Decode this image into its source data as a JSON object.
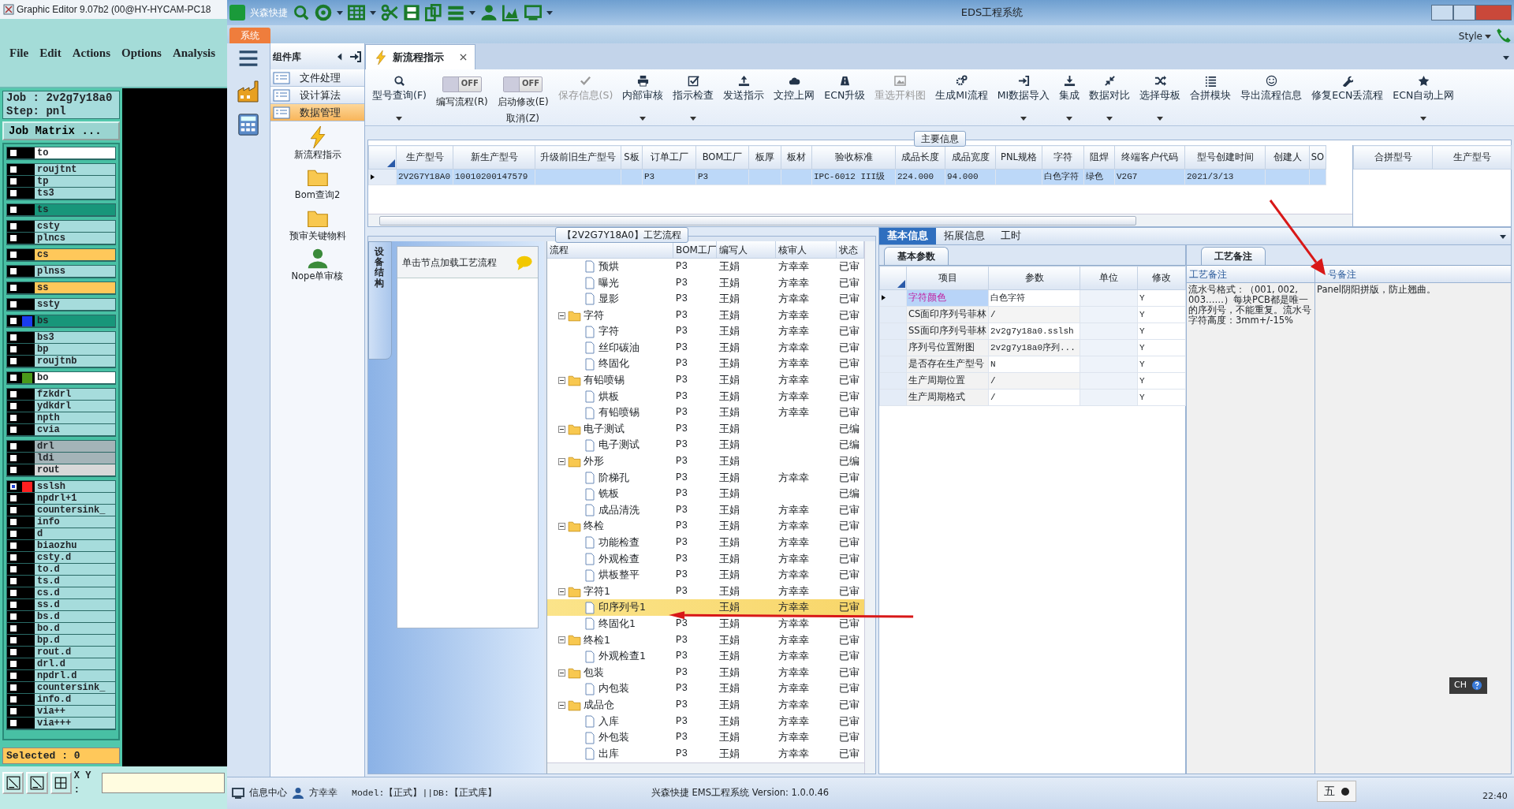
{
  "graphic_editor": {
    "title": "Graphic Editor 9.07b2 (00@HY-HYCAM-PC18",
    "menu": [
      "File",
      "Edit",
      "Actions",
      "Options",
      "Analysis"
    ],
    "job": "Job : 2v2g7y18a0",
    "step": "Step: pnl",
    "job_matrix": "Job Matrix ...",
    "layer_groups": [
      [
        {
          "name": "to",
          "color": "#ffffff",
          "selected": false
        }
      ],
      [
        {
          "name": "roujtnt",
          "color": "#a6dcdc",
          "selected": false
        },
        {
          "name": "tp",
          "color": "#a6dcdc",
          "selected": false
        },
        {
          "name": "ts3",
          "color": "#a6dcdc",
          "selected": false
        }
      ],
      [
        {
          "name": "ts",
          "color": "#18967a",
          "selected": false
        }
      ],
      [
        {
          "name": "csty",
          "color": "#a6dcdc",
          "selected": false
        },
        {
          "name": "plncs",
          "color": "#a6dcdc",
          "selected": false
        }
      ],
      [
        {
          "name": "cs",
          "color": "#ffc85a",
          "selected": false
        }
      ],
      [
        {
          "name": "plnss",
          "color": "#a6dcdc",
          "selected": false
        }
      ],
      [
        {
          "name": "ss",
          "color": "#ffc85a",
          "selected": false
        }
      ],
      [
        {
          "name": "ssty",
          "color": "#a6dcdc",
          "selected": false
        }
      ],
      [
        {
          "name": "bs",
          "color": "#18967a",
          "marker": {
            "color": "#1a3cf0"
          },
          "selected": false
        }
      ],
      [
        {
          "name": "bs3",
          "color": "#a6dcdc",
          "selected": false
        },
        {
          "name": "bp",
          "color": "#a6dcdc",
          "selected": false
        },
        {
          "name": "roujtnb",
          "color": "#a6dcdc",
          "selected": false
        }
      ],
      [
        {
          "name": "bo",
          "color": "#ffffff",
          "marker": {
            "color": "#4a9a1a"
          },
          "selected": false
        }
      ],
      [
        {
          "name": "fzkdrl",
          "color": "#a6dcdc",
          "selected": false
        },
        {
          "name": "ydkdrl",
          "color": "#a6dcdc",
          "selected": false
        },
        {
          "name": "npth",
          "color": "#a6dcdc",
          "selected": false
        },
        {
          "name": "cvia",
          "color": "#a6dcdc",
          "selected": false
        }
      ],
      [
        {
          "name": "drl",
          "color": "#a4b4b8",
          "selected": false
        },
        {
          "name": "ldi",
          "color": "#a4b4b8",
          "selected": false
        },
        {
          "name": "rout",
          "color": "#d8d8d8",
          "selected": false
        }
      ],
      [
        {
          "name": "sslsh",
          "color": "#a6dcdc",
          "marker": {
            "color": "#ff2020"
          },
          "selected": true
        },
        {
          "name": "npdrl+1",
          "color": "#a6dcdc",
          "selected": false
        },
        {
          "name": "countersink_",
          "color": "#a6dcdc",
          "selected": false
        },
        {
          "name": "info",
          "color": "#a6dcdc",
          "selected": false
        },
        {
          "name": "d",
          "color": "#a6dcdc",
          "selected": false
        },
        {
          "name": "biaozhu",
          "color": "#a6dcdc",
          "selected": false
        },
        {
          "name": "csty.d",
          "color": "#a6dcdc",
          "selected": false
        },
        {
          "name": "to.d",
          "color": "#a6dcdc",
          "selected": false
        },
        {
          "name": "ts.d",
          "color": "#a6dcdc",
          "selected": false
        },
        {
          "name": "cs.d",
          "color": "#a6dcdc",
          "selected": false
        },
        {
          "name": "ss.d",
          "color": "#a6dcdc",
          "selected": false
        },
        {
          "name": "bs.d",
          "color": "#a6dcdc",
          "selected": false
        },
        {
          "name": "bo.d",
          "color": "#a6dcdc",
          "selected": false
        },
        {
          "name": "bp.d",
          "color": "#a6dcdc",
          "selected": false
        },
        {
          "name": "rout.d",
          "color": "#a6dcdc",
          "selected": false
        },
        {
          "name": "drl.d",
          "color": "#a6dcdc",
          "selected": false
        },
        {
          "name": "npdrl.d",
          "color": "#a6dcdc",
          "selected": false
        },
        {
          "name": "countersink_",
          "color": "#a6dcdc",
          "selected": false
        },
        {
          "name": "info.d",
          "color": "#a6dcdc",
          "selected": false
        },
        {
          "name": "via++",
          "color": "#a6dcdc",
          "selected": false
        },
        {
          "name": "via+++",
          "color": "#a6dcdc",
          "selected": false
        }
      ]
    ],
    "selected_count": "Selected : 0",
    "xy_label": "X Y :"
  },
  "eds": {
    "title": "EDS工程系统",
    "app_name": "兴森快捷",
    "system_tab": "系统",
    "style_menu": "Style",
    "sidebar": {
      "title": "组件库",
      "categories": [
        {
          "label": "文件处理",
          "selected": false
        },
        {
          "label": "设计算法",
          "selected": false
        },
        {
          "label": "数据管理",
          "selected": true
        }
      ],
      "launchers": [
        {
          "label": "新流程指示"
        },
        {
          "label": "Bom查询2"
        },
        {
          "label": "预审关键物料"
        },
        {
          "label": "Nope单审核"
        }
      ]
    },
    "document_tab": "新流程指示",
    "toolbar": [
      {
        "kind": "button",
        "label": "型号查询(F)",
        "dropdown": true,
        "disabled": false
      },
      {
        "kind": "toggle",
        "label": "编写流程(R)",
        "toggle_text": "OFF",
        "on": false
      },
      {
        "kind": "toggle",
        "label": "启动修改(E)",
        "sublabel": "取消(Z)",
        "toggle_text": "OFF",
        "on": false
      },
      {
        "kind": "button",
        "label": "保存信息(S)",
        "dropdown": false,
        "disabled": true
      },
      {
        "kind": "button",
        "label": "内部审核",
        "dropdown": true,
        "disabled": false
      },
      {
        "kind": "button",
        "label": "指示检查",
        "dropdown": true,
        "disabled": false
      },
      {
        "kind": "button",
        "label": "发送指示",
        "dropdown": false,
        "disabled": false
      },
      {
        "kind": "button",
        "label": "文控上网",
        "dropdown": false,
        "disabled": false
      },
      {
        "kind": "button",
        "label": "ECN升级",
        "dropdown": false,
        "disabled": false
      },
      {
        "kind": "button",
        "label": "重选开料图",
        "dropdown": false,
        "disabled": true
      },
      {
        "kind": "button",
        "label": "生成MI流程",
        "dropdown": false,
        "disabled": false
      },
      {
        "kind": "button",
        "label": "MI数据导入",
        "dropdown": true,
        "disabled": false
      },
      {
        "kind": "button",
        "label": "集成",
        "dropdown": true,
        "disabled": false
      },
      {
        "kind": "button",
        "label": "数据对比",
        "dropdown": true,
        "disabled": false
      },
      {
        "kind": "button",
        "label": "选择母板",
        "dropdown": true,
        "disabled": false
      },
      {
        "kind": "button",
        "label": "合拼模块",
        "dropdown": false,
        "disabled": false
      },
      {
        "kind": "button",
        "label": "导出流程信息",
        "dropdown": false,
        "disabled": false
      },
      {
        "kind": "button",
        "label": "修复ECN丢流程",
        "dropdown": false,
        "disabled": false
      },
      {
        "kind": "button",
        "label": "ECN自动上网",
        "dropdown": true,
        "disabled": false
      }
    ],
    "main_info": {
      "title": "主要信息",
      "columns": [
        "生产型号",
        "新生产型号",
        "升级前旧生产型号",
        "S板",
        "订单工厂",
        "BOM工厂",
        "板厚",
        "板材",
        "验收标准",
        "成品长度",
        "成品宽度",
        "PNL规格",
        "字符",
        "阻焊",
        "终端客户代码",
        "型号创建时间",
        "创建人",
        "SO"
      ],
      "rows": [
        {
          "selected": true,
          "cells": [
            "2V2G7Y18A0",
            "10010200147579",
            null,
            null,
            "P3",
            "P3",
            null,
            null,
            "IPC-6012 III级",
            "224.000",
            "94.000",
            null,
            "白色字符",
            "绿色",
            "V2G7",
            "2021/3/13",
            null,
            null
          ]
        }
      ],
      "side_columns": [
        "合拼型号",
        "生产型号"
      ]
    },
    "process": {
      "title": "【2V2G7Y18A0】工艺流程",
      "side_tab": "设备结构",
      "hint": "单击节点加载工艺流程",
      "columns": [
        "流程",
        "BOM工厂",
        "编写人",
        "核审人",
        "状态"
      ],
      "tree": [
        {
          "kind": "continued",
          "children": [
            {
              "kind": "file",
              "label": "预烘",
              "bom": "P3",
              "writer": "王娟",
              "reviewer": "方幸幸",
              "status": "已审",
              "selected": false
            },
            {
              "kind": "file",
              "label": "曝光",
              "bom": "P3",
              "writer": "王娟",
              "reviewer": "方幸幸",
              "status": "已审",
              "selected": false
            },
            {
              "kind": "file",
              "label": "显影",
              "bom": "P3",
              "writer": "王娟",
              "reviewer": "方幸幸",
              "status": "已审",
              "selected": false
            }
          ]
        },
        {
          "kind": "folder",
          "label": "字符",
          "bom": "P3",
          "writer": "王娟",
          "reviewer": "方幸幸",
          "status": "已审",
          "selected": false,
          "expanded": true,
          "children": [
            {
              "kind": "file",
              "label": "字符",
              "bom": "P3",
              "writer": "王娟",
              "reviewer": "方幸幸",
              "status": "已审",
              "selected": false
            },
            {
              "kind": "file",
              "label": "丝印碳油",
              "bom": "P3",
              "writer": "王娟",
              "reviewer": "方幸幸",
              "status": "已审",
              "selected": false
            },
            {
              "kind": "file",
              "label": "终固化",
              "bom": "P3",
              "writer": "王娟",
              "reviewer": "方幸幸",
              "status": "已审",
              "selected": false
            }
          ]
        },
        {
          "kind": "folder",
          "label": "有铅喷锡",
          "bom": "P3",
          "writer": "王娟",
          "reviewer": "方幸幸",
          "status": "已审",
          "selected": false,
          "expanded": true,
          "children": [
            {
              "kind": "file",
              "label": "烘板",
              "bom": "P3",
              "writer": "王娟",
              "reviewer": "方幸幸",
              "status": "已审",
              "selected": false
            },
            {
              "kind": "file",
              "label": "有铅喷锡",
              "bom": "P3",
              "writer": "王娟",
              "reviewer": "方幸幸",
              "status": "已审",
              "selected": false
            }
          ]
        },
        {
          "kind": "folder",
          "label": "电子测试",
          "bom": "P3",
          "writer": "王娟",
          "status": "已编",
          "selected": false,
          "expanded": true,
          "children": [
            {
              "kind": "file",
              "label": "电子测试",
              "bom": "P3",
              "writer": "王娟",
              "status": "已编",
              "selected": false
            }
          ]
        },
        {
          "kind": "folder",
          "label": "外形",
          "bom": "P3",
          "writer": "王娟",
          "status": "已编",
          "selected": false,
          "expanded": true,
          "children": [
            {
              "kind": "file",
              "label": "阶梯孔",
              "bom": "P3",
              "writer": "王娟",
              "reviewer": "方幸幸",
              "status": "已审",
              "selected": false
            },
            {
              "kind": "file",
              "label": "铣板",
              "bom": "P3",
              "writer": "王娟",
              "status": "已编",
              "selected": false
            },
            {
              "kind": "file",
              "label": "成品清洗",
              "bom": "P3",
              "writer": "王娟",
              "reviewer": "方幸幸",
              "status": "已审",
              "selected": false
            }
          ]
        },
        {
          "kind": "folder",
          "label": "终检",
          "bom": "P3",
          "writer": "王娟",
          "reviewer": "方幸幸",
          "status": "已审",
          "selected": false,
          "expanded": true,
          "children": [
            {
              "kind": "file",
              "label": "功能检查",
              "bom": "P3",
              "writer": "王娟",
              "reviewer": "方幸幸",
              "status": "已审",
              "selected": false
            },
            {
              "kind": "file",
              "label": "外观检查",
              "bom": "P3",
              "writer": "王娟",
              "reviewer": "方幸幸",
              "status": "已审",
              "selected": false
            },
            {
              "kind": "file",
              "label": "烘板整平",
              "bom": "P3",
              "writer": "王娟",
              "reviewer": "方幸幸",
              "status": "已审",
              "selected": false
            }
          ]
        },
        {
          "kind": "folder",
          "label": "字符1",
          "bom": "P3",
          "writer": "王娟",
          "reviewer": "方幸幸",
          "status": "已审",
          "selected": false,
          "expanded": true,
          "children": [
            {
              "kind": "file",
              "label": "印序列号1",
              "writer": "王娟",
              "reviewer": "方幸幸",
              "status": "已审",
              "selected": true
            },
            {
              "kind": "file",
              "label": "终固化1",
              "bom": "P3",
              "writer": "王娟",
              "reviewer": "方幸幸",
              "status": "已审",
              "selected": false
            }
          ]
        },
        {
          "kind": "folder",
          "label": "终检1",
          "bom": "P3",
          "writer": "王娟",
          "reviewer": "方幸幸",
          "status": "已审",
          "selected": false,
          "expanded": true,
          "children": [
            {
              "kind": "file",
              "label": "外观检查1",
              "bom": "P3",
              "writer": "王娟",
              "reviewer": "方幸幸",
              "status": "已审",
              "selected": false
            }
          ]
        },
        {
          "kind": "folder",
          "label": "包装",
          "bom": "P3",
          "writer": "王娟",
          "reviewer": "方幸幸",
          "status": "已审",
          "selected": false,
          "expanded": true,
          "children": [
            {
              "kind": "file",
              "label": "内包装",
              "bom": "P3",
              "writer": "王娟",
              "reviewer": "方幸幸",
              "status": "已审",
              "selected": false
            }
          ]
        },
        {
          "kind": "folder",
          "label": "成品仓",
          "bom": "P3",
          "writer": "王娟",
          "reviewer": "方幸幸",
          "status": "已审",
          "selected": false,
          "expanded": true,
          "children": [
            {
              "kind": "file",
              "label": "入库",
              "bom": "P3",
              "writer": "王娟",
              "reviewer": "方幸幸",
              "status": "已审",
              "selected": false
            },
            {
              "kind": "file",
              "label": "外包装",
              "bom": "P3",
              "writer": "王娟",
              "reviewer": "方幸幸",
              "status": "已审",
              "selected": false
            },
            {
              "kind": "file",
              "label": "出库",
              "bom": "P3",
              "writer": "王娟",
              "reviewer": "方幸幸",
              "status": "已审",
              "selected": false
            }
          ]
        }
      ]
    },
    "detail": {
      "tabs": [
        {
          "label": "基本信息",
          "selected": true
        },
        {
          "label": "拓展信息",
          "selected": false
        },
        {
          "label": "工时",
          "selected": false
        }
      ],
      "subtab": "基本参数",
      "columns": [
        "项目",
        "参数",
        "单位",
        "修改"
      ],
      "rows": [
        {
          "selected": true,
          "cells": [
            "字符颜色",
            "白色字符",
            null,
            "Y"
          ]
        },
        {
          "selected": false,
          "cells": [
            "CS面印序列号菲林",
            "/",
            null,
            "Y"
          ]
        },
        {
          "selected": false,
          "cells": [
            "SS面印序列号菲林",
            "2v2g7y18a0.sslsh",
            null,
            "Y"
          ]
        },
        {
          "selected": false,
          "cells": [
            "序列号位置附图",
            "2v2g7y18a0序列...",
            null,
            "Y"
          ]
        },
        {
          "selected": false,
          "cells": [
            "是否存在生产型号",
            "N",
            null,
            "Y"
          ]
        },
        {
          "selected": false,
          "cells": [
            "生产周期位置",
            "/",
            null,
            "Y"
          ]
        },
        {
          "selected": false,
          "cells": [
            "生产周期格式",
            "/",
            null,
            "Y"
          ]
        }
      ]
    },
    "notes": {
      "tab": "工艺备注",
      "columns": [
        "工艺备注",
        "号备注"
      ],
      "process_note": "流水号格式：（001, 002, 003……）每块PCB都是唯一的序列号，不能重复。流水号字符高度：3mm+/-15%",
      "model_note": "Panel阴阳拼版，防止翘曲。"
    },
    "status_bar": {
      "info_center": "信息中心",
      "user": "方幸幸",
      "model": "Model:【正式】||DB:【正式库】",
      "version": "兴森快捷 EMS工程系统 Version: 1.0.0.46"
    }
  },
  "language_bar": "CH",
  "ime": "五",
  "clock": "22:40"
}
